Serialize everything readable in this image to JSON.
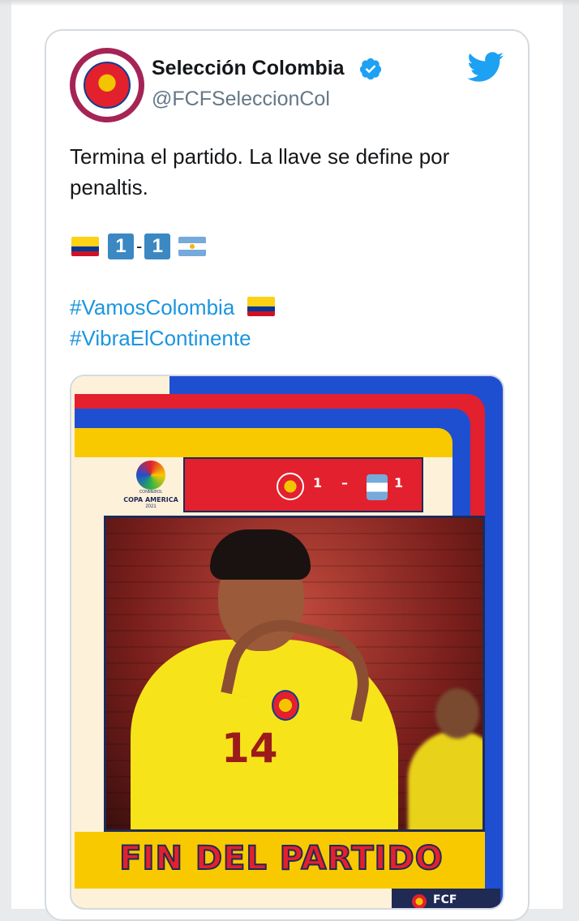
{
  "tweet": {
    "display_name": "Selección Colombia",
    "handle": "@FCFSeleccionCol",
    "text": "Termina el partido. La llave se define por penaltis.",
    "score_home": "1",
    "score_sep": "-",
    "score_away": "1",
    "hashtags": [
      "#VamosColombia",
      "#VibraElContinente"
    ]
  },
  "media": {
    "tournament": "COPA AMERICA",
    "tournament_year": "2021",
    "tournament_top": "CONMEBOL",
    "score_home": "1",
    "score_dash": "–",
    "score_away": "1",
    "headline": "FIN DEL PARTIDO",
    "footer_tag": "FCF",
    "jersey_number": "14"
  },
  "colors": {
    "brand_blue": "#1da1f2",
    "link": "#1b95e0",
    "colombia_yellow": "#fcd116",
    "colombia_red": "#e3202e",
    "colombia_blue": "#1f4fd1"
  },
  "icons": [
    "verified-badge-icon",
    "twitter-bird-icon",
    "colombia-flag-icon",
    "argentina-flag-icon"
  ]
}
